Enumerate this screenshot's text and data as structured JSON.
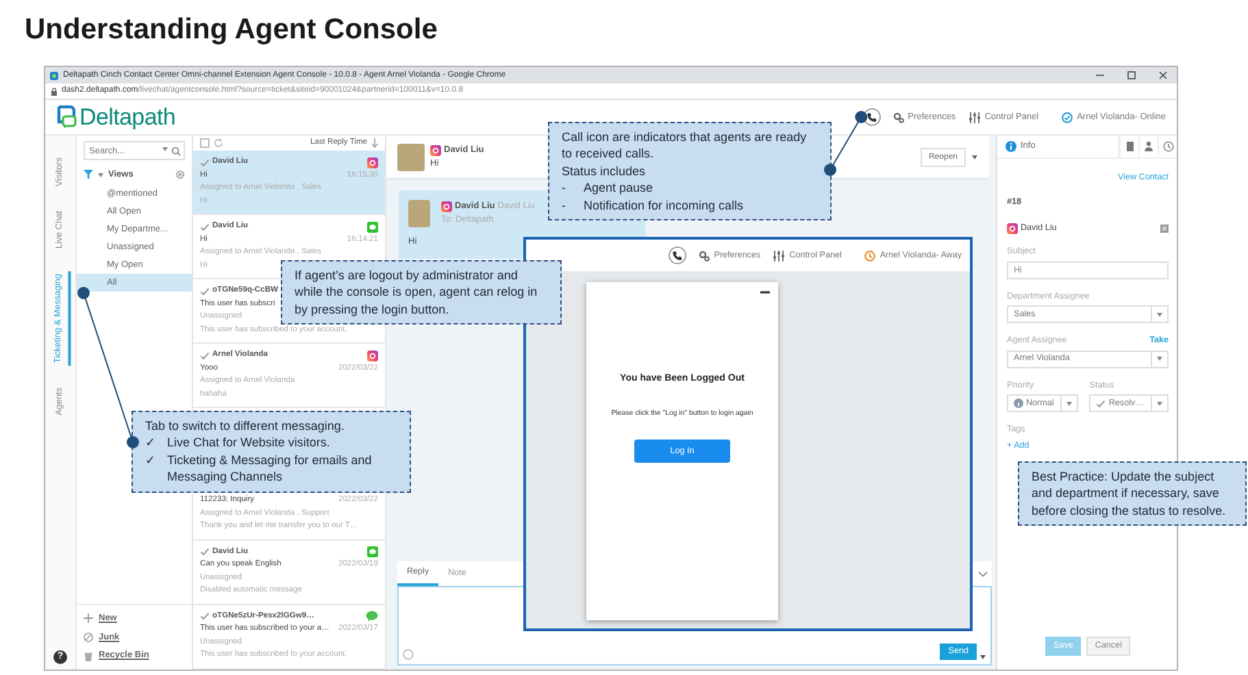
{
  "page_title": "Understanding Agent Console",
  "browser": {
    "title": "Deltapath Cinch Contact Center Omni-channel Extension Agent Console - 10.0.8 - Agent Arnel Violanda - Google Chrome",
    "url_host": "dash2.deltapath.com",
    "url_path": "/livechat/agentconsole.html?source=ticket&siteid=90001024&partnerid=100011&v=10.0.8"
  },
  "app_header": {
    "logo": "Deltapath",
    "links": [
      {
        "label": "Preferences",
        "kind": "preferences"
      },
      {
        "label": "Control Panel",
        "kind": "control_panel"
      }
    ],
    "agent_status": {
      "label": "Arnel Violanda- Online",
      "kind": "online"
    }
  },
  "help": "?",
  "side_tabs": [
    {
      "label": "Visitors",
      "selected": false
    },
    {
      "label": "Live Chat",
      "selected": false
    },
    {
      "label": "Ticketing & Messaging",
      "selected": true
    },
    {
      "label": "Agents",
      "selected": false
    }
  ],
  "views": {
    "search_placeholder": "Search...",
    "title": "Views",
    "items": [
      {
        "label": "@mentioned",
        "selected": false
      },
      {
        "label": "All Open",
        "selected": false
      },
      {
        "label": "My Departme...",
        "selected": false
      },
      {
        "label": "Unassigned",
        "selected": false
      },
      {
        "label": "My Open",
        "selected": false
      },
      {
        "label": "All",
        "selected": true
      }
    ],
    "footer": [
      {
        "label": "New",
        "kind": "new"
      },
      {
        "label": "Junk",
        "kind": "junk"
      },
      {
        "label": "Recycle Bin",
        "kind": "bin"
      }
    ]
  },
  "conversation_list": {
    "select_all_checked": false,
    "sort_label": "Last Reply Time",
    "items": [
      {
        "name": "David Liu",
        "kind": "instagram",
        "subject": "Hi",
        "time": "16:15:30",
        "assignee": "Assigned to Arnel Violanda , Sales",
        "preview": "Hi",
        "selected": true
      },
      {
        "name": "David Liu",
        "kind": "line",
        "subject": "Hi",
        "time": "16:14:21",
        "assignee": "Assigned to Arnel Violanda , Sales",
        "preview": "Hi",
        "selected": false
      },
      {
        "name": "oTGNe59q-CcBW",
        "subject": "This user has subscri",
        "assignee": "Unassigned",
        "preview": "This user has subscribed to your account.",
        "selected": false
      },
      {
        "name": "Arnel Violanda",
        "kind": "instagram",
        "subject": "Yooo",
        "time": "2022/03/22",
        "assignee": "Assigned to Arnel Violanda",
        "preview": "hahaha",
        "selected": false
      },
      {
        "subject": "112233: Inquiry",
        "time": "2022/03/22",
        "assignee": "Assigned to Arnel Violanda , Support",
        "preview": "Thank you and let me transfer you to our T…",
        "selected": false
      },
      {
        "name": "David Liu",
        "kind": "line",
        "subject": "Can you speak English",
        "time": "2022/03/19",
        "assignee": "Unassigned",
        "preview": "Disabled automatic message",
        "selected": false
      },
      {
        "name": "oTGNe5zUr-Pesx2lGGw9…",
        "kind": "wechat",
        "subject": "This user has subscribed to your a…",
        "time": "2022/03/17",
        "assignee": "Unassigned",
        "preview": "This user has subscribed to your account.",
        "selected": false
      }
    ]
  },
  "chat": {
    "header": {
      "name": "David Liu",
      "kind": "instagram",
      "text": "Hi"
    },
    "reopen": "Reopen",
    "messages": [
      {
        "name": "David Liu",
        "kind": "instagram",
        "sender": "David Liu",
        "to": "To: Deltapath",
        "text": "Hi"
      }
    ],
    "composer": {
      "tabs": [
        {
          "label": "Reply",
          "selected": true
        },
        {
          "label": "Note",
          "selected": false
        }
      ],
      "send": "Send"
    }
  },
  "info": {
    "tab": {
      "label": "Info",
      "selected": true
    },
    "view_contact": "View Contact",
    "ticket": "#18",
    "contact": {
      "name": "David Liu",
      "kind": "instagram"
    },
    "fields": [
      {
        "label": "Subject",
        "value": "Hi",
        "kind": "text"
      },
      {
        "label": "Department Assignee",
        "value": "Sales",
        "kind": "select"
      },
      {
        "label": "Agent Assignee",
        "value": "Arnel Violanda",
        "kind": "select",
        "action": "Take"
      }
    ],
    "priority": {
      "label": "Priority",
      "value": "Normal"
    },
    "status": {
      "label": "Status",
      "value": "Resolv…"
    },
    "tags_label": "Tags",
    "add_tag": "+ Add",
    "buttons": [
      {
        "label": "Save",
        "kind": "primary",
        "disabled": true
      },
      {
        "label": "Cancel",
        "kind": "secondary",
        "disabled": false
      }
    ]
  },
  "logged_out_screenshot": {
    "links": [
      {
        "label": "Preferences",
        "kind": "preferences"
      },
      {
        "label": "Control Panel",
        "kind": "control_panel"
      }
    ],
    "agent_status": {
      "label": "Arnel Violanda- Away",
      "kind": "away"
    },
    "dialog": {
      "title": "You have Been Logged Out",
      "message": "Please click the \"Log in\" button to login again",
      "button": "Log In"
    }
  },
  "callouts": [
    {
      "kind": "call_icon",
      "text": "Call icon are indicators that agents are ready to received calls.",
      "subtext": "Status includes",
      "bullets": [
        {
          "marker": "-",
          "text": "Agent pause"
        },
        {
          "marker": "-",
          "text": "Notification for incoming calls"
        }
      ]
    },
    {
      "kind": "relog",
      "text": "If agent’s are logout by administrator and while the console is open, agent can relog in by pressing the login button."
    },
    {
      "kind": "tabs",
      "text": "Tab to switch to different messaging.",
      "bullets": [
        {
          "marker": "✓",
          "text": "Live Chat for Website visitors."
        },
        {
          "marker": "✓",
          "text": "Ticketing & Messaging for emails and Messaging Channels"
        }
      ]
    },
    {
      "kind": "best_practice",
      "text": "Best Practice: Update the subject and department if necessary, save before closing the status to resolve."
    }
  ]
}
